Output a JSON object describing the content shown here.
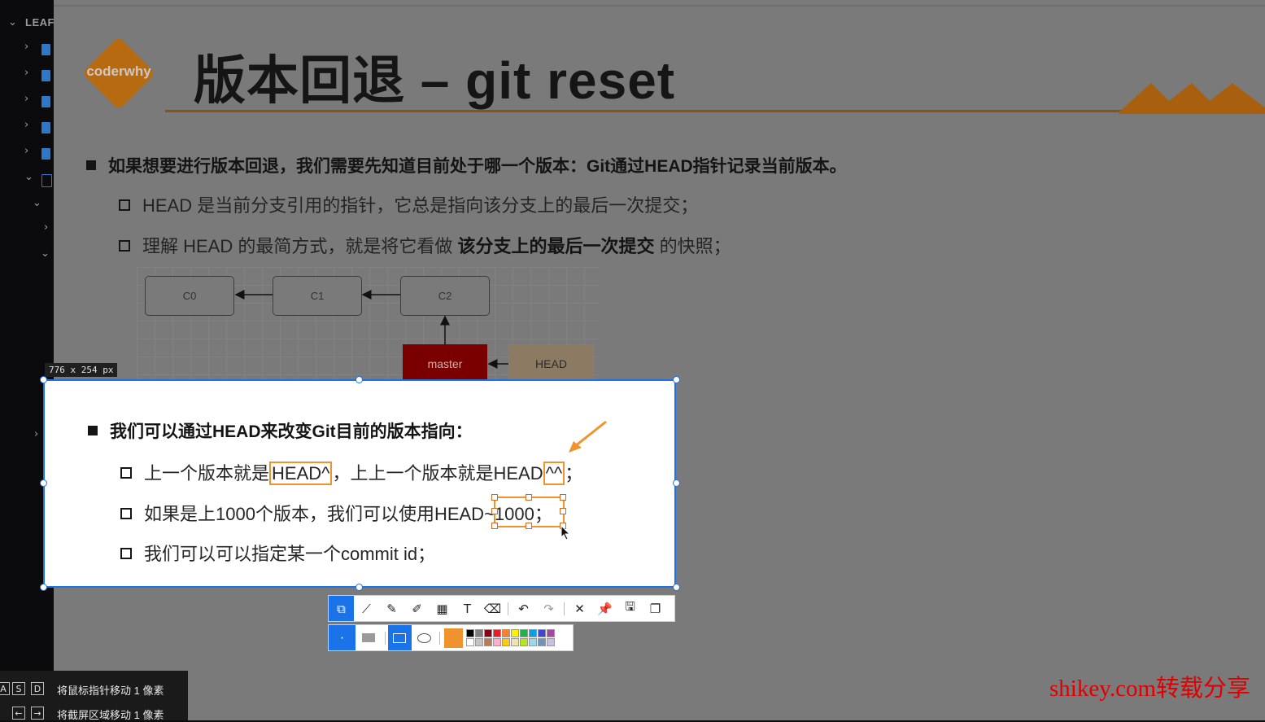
{
  "editor_sidebar": {
    "header": "LEAF"
  },
  "slide": {
    "logo_text": "coderwhy",
    "title": "版本回退 – git reset",
    "bullets": [
      {
        "text": "如果想要进行版本回退，我们需要先知道目前处于哪一个版本：Git通过HEAD指针记录当前版本。"
      },
      {
        "text": "HEAD 是当前分支引用的指针，它总是指向该分支上的最后一次提交；"
      },
      {
        "text_a": "理解 HEAD 的最简方式，就是将它看做 ",
        "text_b": "该分支上的最后一次提交",
        "text_c": " 的快照；"
      }
    ],
    "diagram": {
      "commits": [
        "C0",
        "C1",
        "C2"
      ],
      "master_label": "master",
      "head_label": "HEAD"
    }
  },
  "selection": {
    "size_label": "776 x 254   px",
    "main_bullet": "我们可以通过HEAD来改变Git目前的版本指向：",
    "sub1_a": "上一个版本就是",
    "sub1_hl": "HEAD^",
    "sub1_b": "，上上一个版本就是HEAD",
    "sub1_hl2": "^^",
    "sub1_c": "；",
    "sub2_a": "如果是上1000个版本，我们可以使用HEAD",
    "sub2_b": "~1000",
    "sub2_c": "；",
    "sub3": "我们可以可以指定某一个commit id；"
  },
  "toolbar": {
    "tools": [
      "select-area-icon",
      "polyline-icon",
      "pencil-icon",
      "marker-icon",
      "mosaic-icon",
      "text-icon",
      "eraser-icon",
      "undo-icon",
      "redo-icon",
      "close-icon",
      "pin-icon",
      "save-icon",
      "copy-icon"
    ],
    "accent_color": "#1a73e8",
    "current_color": "#f0932e",
    "palette": [
      "#000000",
      "#7f7f7f",
      "#880015",
      "#ed1c24",
      "#ff7f27",
      "#fff200",
      "#22b14c",
      "#00a2e8",
      "#3f48cc",
      "#a349a4",
      "#ffffff",
      "#c3c3c3",
      "#b97a57",
      "#ffaec9",
      "#ffc90e",
      "#efe4b0",
      "#b5e61d",
      "#99d9ea",
      "#7092be",
      "#c8bfe7"
    ]
  },
  "keyboard_hints": {
    "row1_keys": [
      "A",
      "S",
      "D"
    ],
    "row1_text": "将鼠标指针移动 1 像素",
    "row2_keys": [
      "←",
      "→"
    ],
    "row2_text": "将截屏区域移动 1 像素"
  },
  "watermark": "shikey.com转载分享"
}
